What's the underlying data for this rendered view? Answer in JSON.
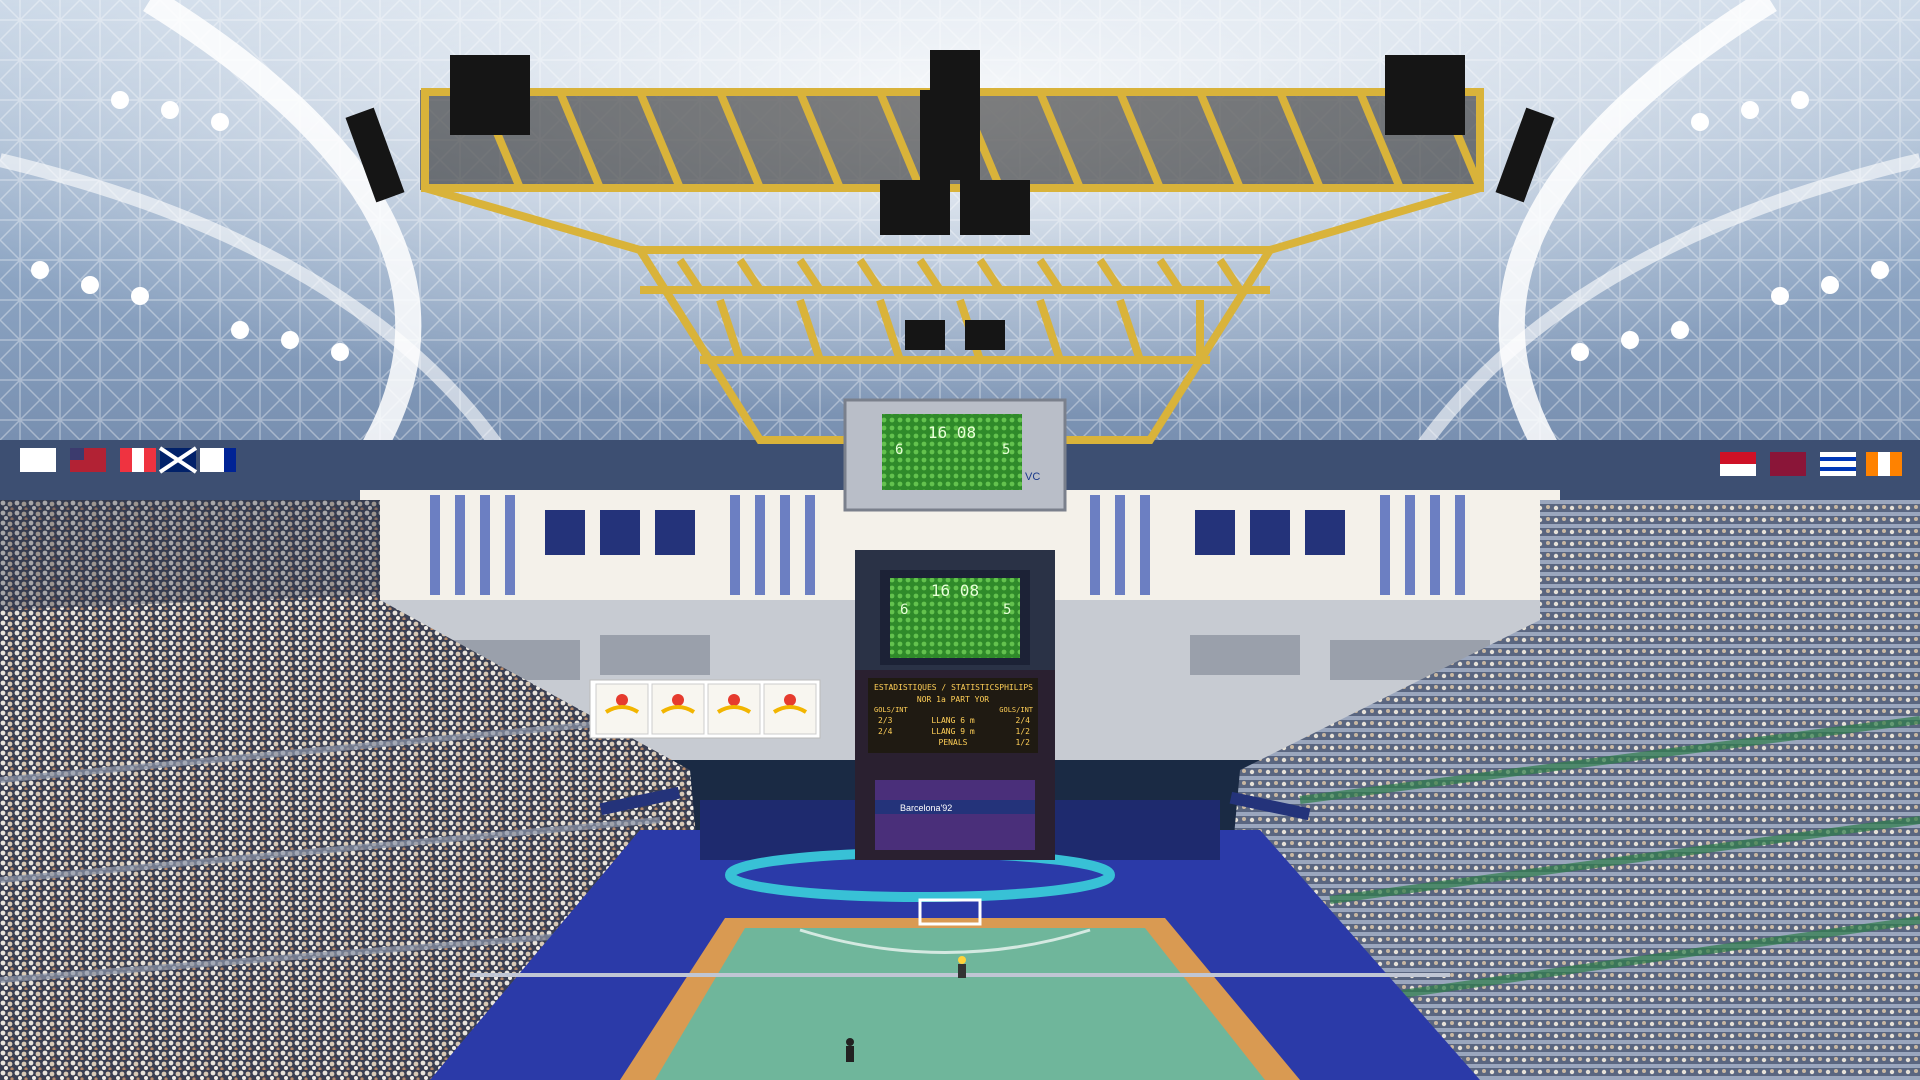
{
  "scene": {
    "description_free": true,
    "colors": {
      "roof": "#8ea6c4",
      "truss": "#d9b33a",
      "court": "#6fb69b",
      "court_border": "#d99a52",
      "floor": "#2b3aa8",
      "board_bg": "#3a8a2e",
      "text_board_bg": "#1f1a12"
    }
  },
  "scoreboard_upper": {
    "time": "16 08",
    "left_score": "6",
    "right_score": "5",
    "brand": "VC"
  },
  "scoreboard_lower": {
    "time": "16 08",
    "left_score": "6",
    "right_score": "5"
  },
  "stats_board": {
    "header_left": "ESTADISTIQUES / STATISTICS",
    "header_right": "PHILIPS",
    "subheader": "NOR  1a PART  YOR",
    "col_left_title": "GOLS/INT",
    "col_right_title": "GOLS/INT",
    "rows": [
      {
        "left": "2/3",
        "mid": "LLANG 6 m",
        "right": "2/4"
      },
      {
        "left": "2/4",
        "mid": "LLANG 9 m",
        "right": "1/2"
      },
      {
        "left": "",
        "mid": "PENALS",
        "right": "1/2"
      }
    ]
  },
  "banners": {
    "sponsor_text": "Barcelona'92"
  }
}
